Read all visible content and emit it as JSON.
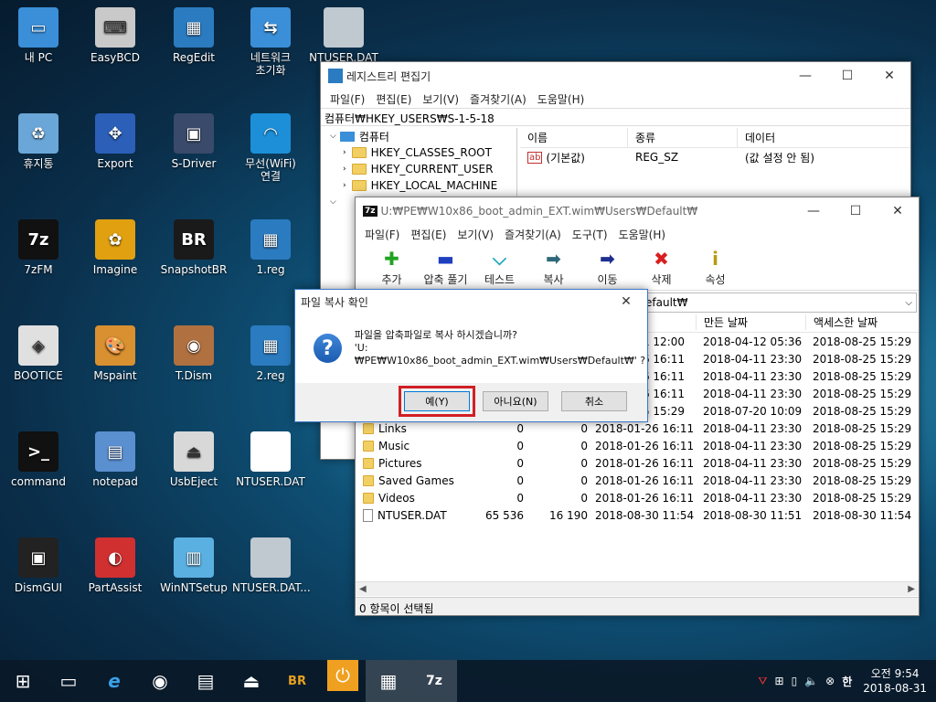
{
  "desktop": {
    "icons": [
      {
        "label": "내 PC",
        "icon": "computer-icon",
        "color": "#3a8fd8",
        "glyph": "▭"
      },
      {
        "label": "EasyBCD",
        "icon": "easybcd-icon",
        "color": "#c9c9c9",
        "glyph": "⌨"
      },
      {
        "label": "RegEdit",
        "icon": "regedit-icon",
        "color": "#2b7bc0",
        "glyph": "▦"
      },
      {
        "label": "네트워크\n초기화",
        "icon": "network-reset-icon",
        "color": "#3a8fd8",
        "glyph": "⇆"
      },
      {
        "label": "휴지통",
        "icon": "recycle-bin-icon",
        "color": "#6aa7d8",
        "glyph": "♻"
      },
      {
        "label": "Export",
        "icon": "export-icon",
        "color": "#2b5fb8",
        "glyph": "✥"
      },
      {
        "label": "S-Driver",
        "icon": "driver-icon",
        "color": "#3a4a6a",
        "glyph": "▣"
      },
      {
        "label": "무선(WiFi)\n연결",
        "icon": "wifi-icon",
        "color": "#1c8fd8",
        "glyph": "◠"
      },
      {
        "label": "7zFM",
        "icon": "7zip-icon",
        "color": "#111111",
        "glyph": "7z"
      },
      {
        "label": "Imagine",
        "icon": "imagine-icon",
        "color": "#e0a010",
        "glyph": "✿"
      },
      {
        "label": "SnapshotBR",
        "icon": "snapshot-icon",
        "color": "#1a1a1a",
        "glyph": "BR"
      },
      {
        "label": "1.reg",
        "icon": "reg-file-icon",
        "color": "#2b7bc0",
        "glyph": "▦"
      },
      {
        "label": "BOOTICE",
        "icon": "bootice-icon",
        "color": "#e0e0e0",
        "glyph": "◈"
      },
      {
        "label": "Mspaint",
        "icon": "paint-icon",
        "color": "#d89030",
        "glyph": "🎨"
      },
      {
        "label": "T.Dism",
        "icon": "dism-icon",
        "color": "#b07040",
        "glyph": "◉"
      },
      {
        "label": "2.reg",
        "icon": "reg-file-icon",
        "color": "#2b7bc0",
        "glyph": "▦"
      },
      {
        "label": "command",
        "icon": "cmd-icon",
        "color": "#111111",
        "glyph": ">_"
      },
      {
        "label": "notepad",
        "icon": "notepad-icon",
        "color": "#5a8fd0",
        "glyph": "▤"
      },
      {
        "label": "UsbEject",
        "icon": "usb-eject-icon",
        "color": "#d8d8d8",
        "glyph": "⏏"
      },
      {
        "label": "NTUSER.DAT",
        "icon": "file-icon",
        "color": "#ffffff",
        "glyph": ""
      },
      {
        "label": "DismGUI",
        "icon": "dismgui-icon",
        "color": "#222222",
        "glyph": "▣"
      },
      {
        "label": "PartAssist",
        "icon": "partassist-icon",
        "color": "#d03030",
        "glyph": "◐"
      },
      {
        "label": "WinNTSetup",
        "icon": "winntsetup-icon",
        "color": "#5ab0e0",
        "glyph": "▥"
      },
      {
        "label": "NTUSER.DAT...",
        "icon": "file-icon",
        "color": "#c0c8d0",
        "glyph": ""
      }
    ],
    "partial_icon_label": "NTUSER.DAT"
  },
  "regedit": {
    "title": "레지스트리 편집기",
    "menu": [
      "파일(F)",
      "편집(E)",
      "보기(V)",
      "즐겨찾기(A)",
      "도움말(H)"
    ],
    "address": "컴퓨터₩HKEY_USERS₩S-1-5-18",
    "tree_root": "컴퓨터",
    "tree": [
      "HKEY_CLASSES_ROOT",
      "HKEY_CURRENT_USER",
      "HKEY_LOCAL_MACHINE"
    ],
    "columns": [
      "이름",
      "종류",
      "데이터"
    ],
    "rows": [
      {
        "name": "(기본값)",
        "type": "REG_SZ",
        "data": "(값 설정 안 됨)"
      }
    ]
  },
  "zfm": {
    "title": "U:₩PE₩W10x86_boot_admin_EXT.wim₩Users₩Default₩",
    "menu": [
      "파일(F)",
      "편집(E)",
      "보기(V)",
      "즐겨찾기(A)",
      "도구(T)",
      "도움말(H)"
    ],
    "tools": [
      {
        "label": "추가",
        "icon": "add-icon",
        "glyph": "✚",
        "color": "#21a321"
      },
      {
        "label": "압축 풀기",
        "icon": "extract-icon",
        "glyph": "▬",
        "color": "#1f3fbf"
      },
      {
        "label": "테스트",
        "icon": "test-icon",
        "glyph": "⌵",
        "color": "#19a7b8"
      },
      {
        "label": "복사",
        "icon": "copy-icon",
        "glyph": "➡",
        "color": "#2f6a7a"
      },
      {
        "label": "이동",
        "icon": "move-icon",
        "glyph": "➡",
        "color": "#1f2f8f"
      },
      {
        "label": "삭제",
        "icon": "delete-icon",
        "glyph": "✖",
        "color": "#d81f1f"
      },
      {
        "label": "속성",
        "icon": "info-icon",
        "glyph": "i",
        "color": "#b89a10"
      }
    ],
    "address": "efault₩",
    "columns": {
      "created": "만든 날짜",
      "accessed": "액세스한 날짜"
    },
    "partial_rows": [
      {
        "modified": "1 12:00",
        "created": "2018-04-12 05:36",
        "accessed": "2018-08-25 15:29"
      },
      {
        "modified": "6 16:11",
        "created": "2018-04-11 23:30",
        "accessed": "2018-08-25 15:29"
      },
      {
        "modified": "6 16:11",
        "created": "2018-04-11 23:30",
        "accessed": "2018-08-25 15:29"
      },
      {
        "modified": "6 16:11",
        "created": "2018-04-11 23:30",
        "accessed": "2018-08-25 15:29"
      },
      {
        "modified": "5 15:29",
        "created": "2018-07-20 10:09",
        "accessed": "2018-08-25 15:29"
      }
    ],
    "rows": [
      {
        "name": "Links",
        "size": "0",
        "packed": "0",
        "modified": "2018-01-26 16:11",
        "created": "2018-04-11 23:30",
        "accessed": "2018-08-25 15:29",
        "kind": "folder"
      },
      {
        "name": "Music",
        "size": "0",
        "packed": "0",
        "modified": "2018-01-26 16:11",
        "created": "2018-04-11 23:30",
        "accessed": "2018-08-25 15:29",
        "kind": "folder"
      },
      {
        "name": "Pictures",
        "size": "0",
        "packed": "0",
        "modified": "2018-01-26 16:11",
        "created": "2018-04-11 23:30",
        "accessed": "2018-08-25 15:29",
        "kind": "folder"
      },
      {
        "name": "Saved Games",
        "size": "0",
        "packed": "0",
        "modified": "2018-01-26 16:11",
        "created": "2018-04-11 23:30",
        "accessed": "2018-08-25 15:29",
        "kind": "folder"
      },
      {
        "name": "Videos",
        "size": "0",
        "packed": "0",
        "modified": "2018-01-26 16:11",
        "created": "2018-04-11 23:30",
        "accessed": "2018-08-25 15:29",
        "kind": "folder"
      },
      {
        "name": "NTUSER.DAT",
        "size": "65 536",
        "packed": "16 190",
        "modified": "2018-08-30 11:54",
        "created": "2018-08-30 11:51",
        "accessed": "2018-08-30 11:54",
        "kind": "file"
      }
    ],
    "status": "0 항목이 선택됨"
  },
  "dialog": {
    "title": "파일 복사 확인",
    "message_line1": "파일을 압축파일로 복사 하시겠습니까?",
    "message_line2": "'U:₩PE₩W10x86_boot_admin_EXT.wim₩Users₩Default₩' ?",
    "yes": "예(Y)",
    "no": "아니요(N)",
    "cancel": "취소"
  },
  "taskbar": {
    "items": [
      {
        "icon": "start-icon",
        "glyph": "⊞"
      },
      {
        "icon": "computer-icon",
        "glyph": "▭"
      },
      {
        "icon": "ie-icon",
        "glyph": "e"
      },
      {
        "icon": "dism-icon",
        "glyph": "◉"
      },
      {
        "icon": "notepad-icon",
        "glyph": "▤"
      },
      {
        "icon": "usb-eject-icon",
        "glyph": "⏏"
      },
      {
        "icon": "snapshot-icon",
        "glyph": "BR"
      },
      {
        "icon": "power-icon",
        "glyph": "⏻"
      },
      {
        "icon": "regedit-icon",
        "glyph": "▦"
      },
      {
        "icon": "7zip-icon",
        "glyph": "7z"
      }
    ],
    "tray_ime": "한",
    "time": "오전 9:54",
    "date": "2018-08-31"
  }
}
